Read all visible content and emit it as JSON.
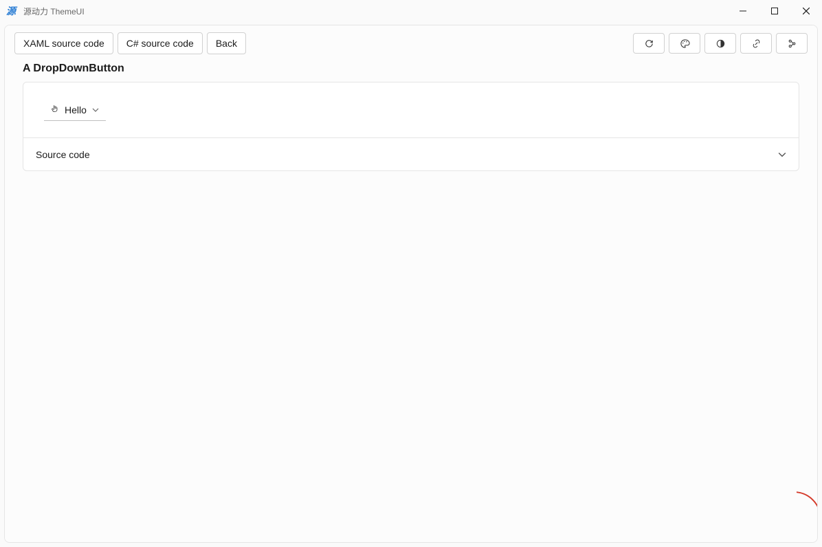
{
  "window": {
    "title": "源动力 ThemeUI"
  },
  "toolbar": {
    "xaml_label": "XAML source code",
    "csharp_label": "C# source code",
    "back_label": "Back"
  },
  "page": {
    "heading": "A DropDownButton",
    "dropdown_label": "Hello",
    "source_code_label": "Source code"
  }
}
